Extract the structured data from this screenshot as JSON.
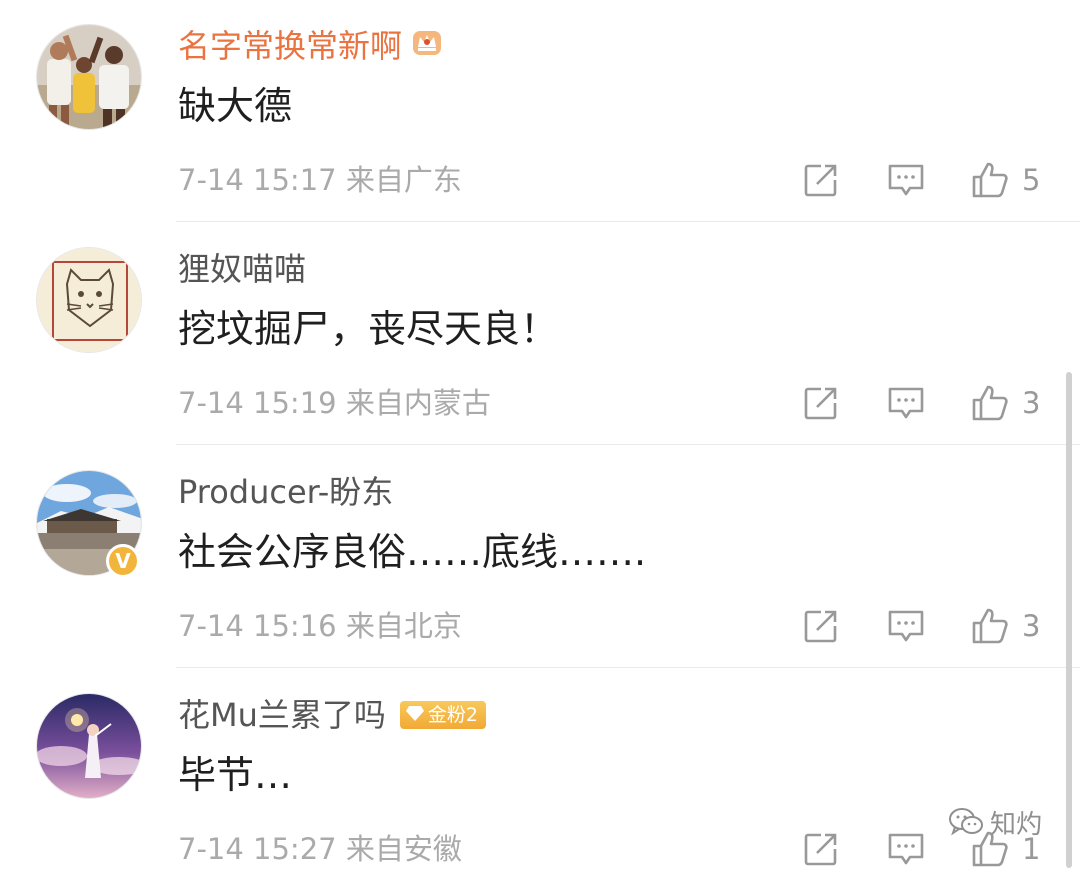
{
  "comments": [
    {
      "username": "名字常换常新啊",
      "text": "缺大德",
      "time": "7-14 15:17",
      "location": "来自广东",
      "likes": "5",
      "username_color": "#eb7340",
      "badge_icon": "crown-icon"
    },
    {
      "username": "狸奴喵喵",
      "text": "挖坟掘尸，丧尽天良！",
      "time": "7-14 15:19",
      "location": "来自内蒙古",
      "likes": "3"
    },
    {
      "username": "Producer-盼东",
      "text": "社会公序良俗……底线…….",
      "time": "7-14 15:16",
      "location": "来自北京",
      "likes": "3",
      "verified": true,
      "verified_glyph": "V"
    },
    {
      "username": "花Mu兰累了吗",
      "text": "毕节…",
      "time": "7-14 15:27",
      "location": "来自安徽",
      "likes": "1",
      "fan_badge": "金粉2"
    }
  ],
  "watermark": {
    "icon": "wechat-icon",
    "text": "知灼"
  },
  "colors": {
    "vip_name": "#eb7340",
    "name": "#555555",
    "text": "#1f1f1f",
    "meta": "#aaaaaa",
    "badge_gold": "#f2b53c"
  }
}
